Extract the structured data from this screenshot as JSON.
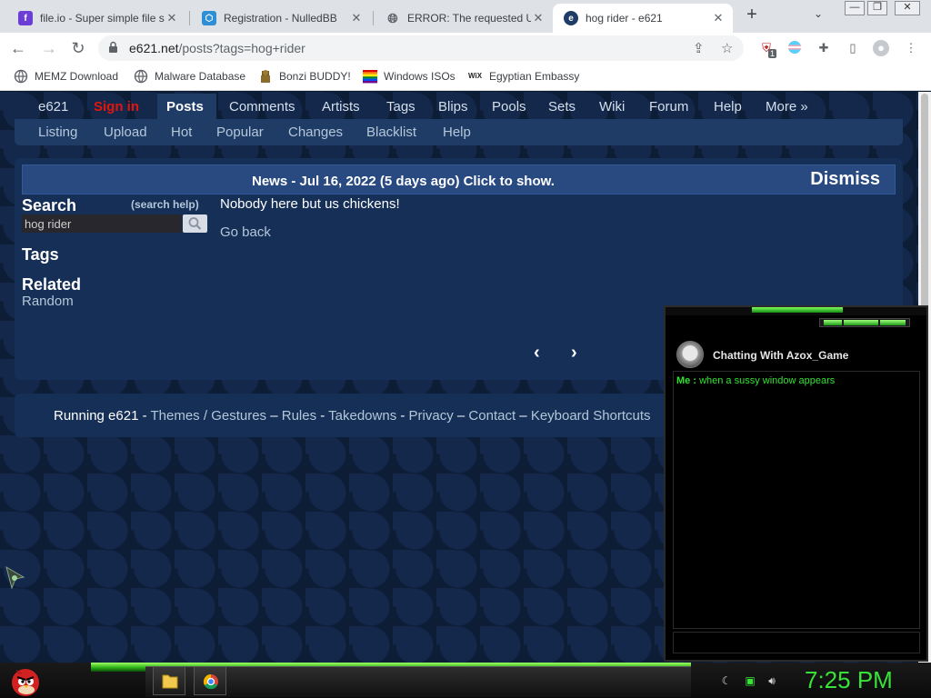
{
  "browser": {
    "tabs": [
      {
        "title": "file.io - Super simple file sharing",
        "favicon": "file-io"
      },
      {
        "title": "Registration - NulledBB",
        "favicon": "nulledbb"
      },
      {
        "title": "ERROR: The requested URL could not be retrieved",
        "favicon": "globe"
      },
      {
        "title": "hog rider - e621",
        "favicon": "e621",
        "active": true
      }
    ],
    "new_tab": "+",
    "tab_list": "⌄",
    "url_host": "e621.net",
    "url_path": "/posts?tags=hog+rider",
    "extension_badge": "1",
    "bookmarks": [
      {
        "label": "MEMZ Download",
        "icon": "globe"
      },
      {
        "label": "Malware Database",
        "icon": "globe"
      },
      {
        "label": "Bonzi BUDDY!",
        "icon": "bonzi"
      },
      {
        "label": "Windows ISOs",
        "icon": "windows-flag"
      },
      {
        "label": "Egyptian Embassy",
        "icon": "wix"
      }
    ]
  },
  "site": {
    "nav": [
      "e621",
      "Sign in",
      "Posts",
      "Comments",
      "Artists",
      "Tags",
      "Blips",
      "Pools",
      "Sets",
      "Wiki",
      "Forum",
      "Help",
      "More »"
    ],
    "subnav": [
      "Listing",
      "Upload",
      "Hot",
      "Popular",
      "Changes",
      "Blacklist",
      "Help"
    ],
    "news": "News - Jul 16, 2022 (5 days ago) Click to show.",
    "dismiss": "Dismiss",
    "search_title": "Search",
    "search_help": "(search help)",
    "search_value": "hog rider",
    "tags_title": "Tags",
    "related_title": "Related",
    "random": "Random",
    "empty_message": "Nobody here but us chickens!",
    "go_back": "Go back",
    "prev": "‹",
    "next": "›",
    "footer": {
      "running": "Running e621",
      "sep1": " - ",
      "themes": "Themes",
      "slash": " / ",
      "gestures": "Gestures",
      "sep2": " – ",
      "rules": "Rules",
      "sep3": " - ",
      "takedowns": "Takedowns",
      "sep4": " - ",
      "privacy": "Privacy",
      "sep5": " – ",
      "contact": "Contact",
      "sep6": " – ",
      "shortcuts": "Keyboard Shortcuts"
    }
  },
  "chat": {
    "title": "Chatting With Azox_Game",
    "sender": "Me :",
    "message": "when a sussy window appears"
  },
  "taskbar": {
    "clock": "7:25 PM"
  },
  "colors": {
    "page_bg": "#0d1d36",
    "panel": "#152f56",
    "link": "#b4c7d9",
    "sign_in": "#e4150f",
    "accent_green": "#39e239"
  }
}
